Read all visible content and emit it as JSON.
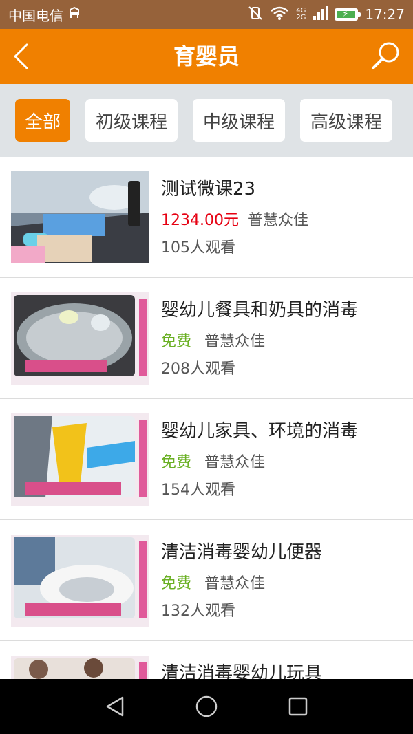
{
  "statusbar": {
    "carrier": "中国电信",
    "network_top": "4G",
    "network_bottom": "2G",
    "time": "17:27"
  },
  "navbar": {
    "title": "育婴员"
  },
  "filters": [
    {
      "label": "全部",
      "active": true
    },
    {
      "label": "初级课程",
      "active": false
    },
    {
      "label": "中级课程",
      "active": false
    },
    {
      "label": "高级课程",
      "active": false
    }
  ],
  "courses": [
    {
      "title": "测试微课23",
      "price": "1234.00元",
      "org": "普慧众佳",
      "views": "105人观看"
    },
    {
      "title": "婴幼儿餐具和奶具的消毒",
      "price": "免费",
      "org": "普慧众佳",
      "views": "208人观看"
    },
    {
      "title": "婴幼儿家具、环境的消毒",
      "price": "免费",
      "org": "普慧众佳",
      "views": "154人观看"
    },
    {
      "title": "清洁消毒婴幼儿便器",
      "price": "免费",
      "org": "普慧众佳",
      "views": "132人观看"
    },
    {
      "title": "清洁消毒婴幼儿玩具",
      "price": "",
      "org": "",
      "views": ""
    }
  ],
  "colors": {
    "accent": "#f08000",
    "paid_price": "#e60012",
    "free_price": "#6ab023",
    "statusbar": "#96623a"
  }
}
